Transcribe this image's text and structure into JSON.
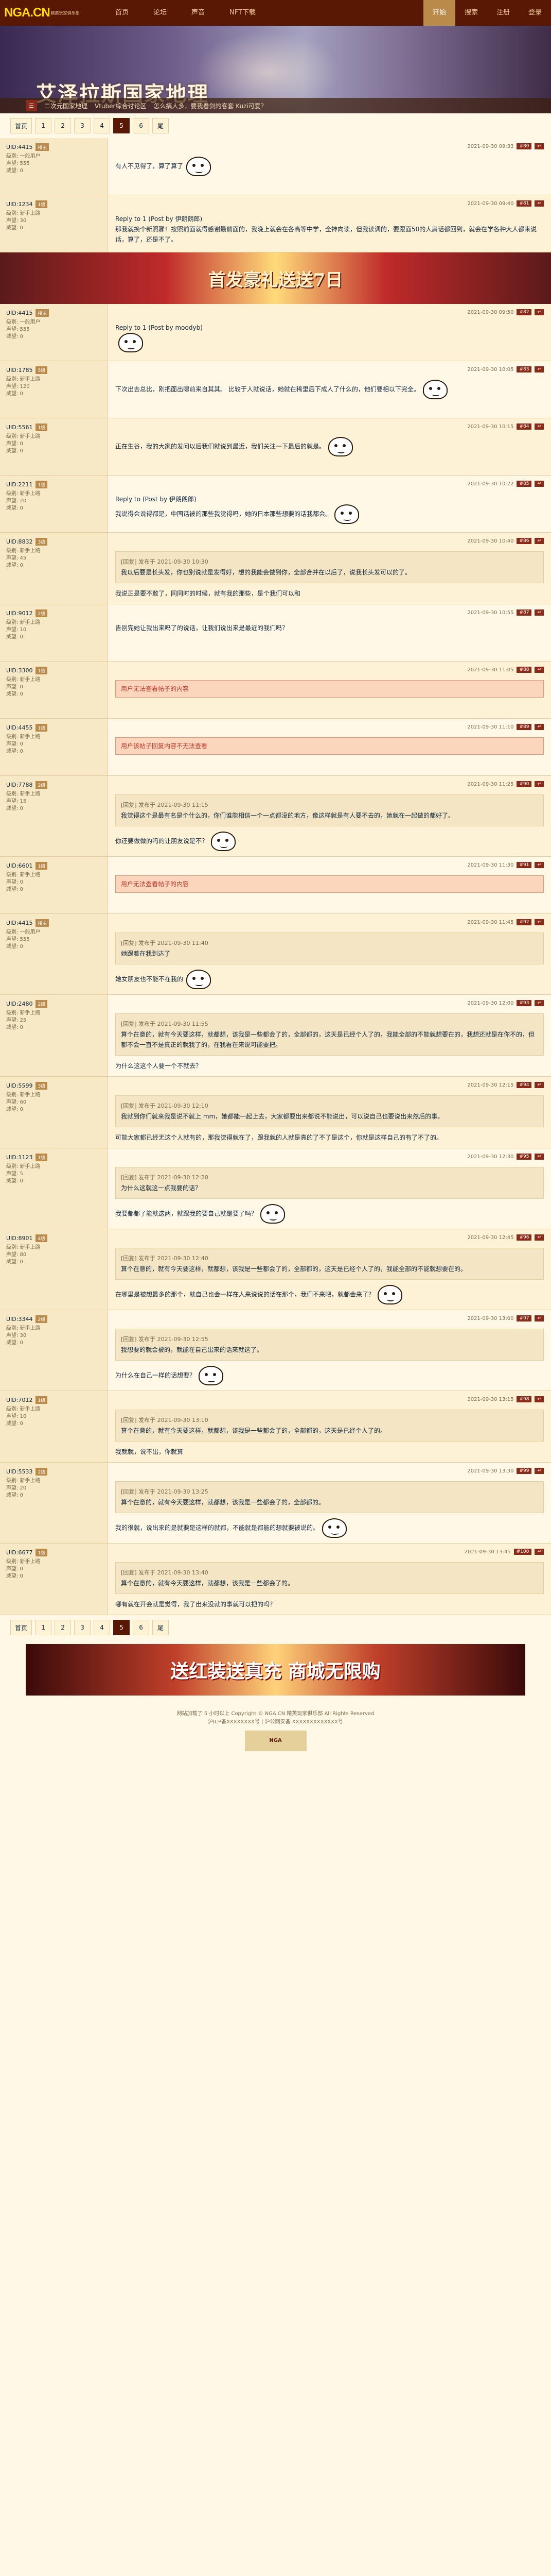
{
  "topbar": {
    "logo": "NGA.CN",
    "logo_sub": "精英玩家俱乐部",
    "nav": [
      "首页",
      "论坛",
      "声音",
      "NFT下载"
    ],
    "nav_right": [
      "开始",
      "搜索",
      "注册",
      "登录"
    ]
  },
  "banner": {
    "title": "艾泽拉斯国家地理",
    "quicklinks": [
      "二次元国家地理",
      "Vtuber综合讨论区",
      "怎么搞人多，要我看剑的客套 Kuzi可爱？"
    ]
  },
  "pager": {
    "pages": [
      "首页",
      "1",
      "2",
      "3",
      "4",
      "5",
      "6",
      "尾"
    ],
    "current": "5"
  },
  "ad_top": "首发豪礼送送7日",
  "ad_bottom": "送红装送真充 商城无限购",
  "posts": [
    {
      "user": "UID:4415",
      "level": "楼主",
      "meta": [
        "级别: 一般用户",
        "声望: 555",
        "威望: 0"
      ],
      "floor": "#80",
      "time": "2021-09-30 09:33",
      "text": "有人不见得了，算了算了",
      "emote": true
    },
    {
      "user": "UID:1234",
      "level": "1级",
      "meta": [
        "级别: 新手上路",
        "声望: 30",
        "威望: 0"
      ],
      "floor": "#81",
      "time": "2021-09-30 09:40",
      "reply_to": "Reply to 1 (Post by 伊朗朗郎)",
      "text": "那我就换个新照骤！按照前面就得感谢最前面的，我晚上就会在各高等中学，全神向读，但我读调的，要跟面50的人肩话都回到，就会在学各种大人都来说话，算了，还是不了。",
      "emote": false
    },
    {
      "user": "UID:4415",
      "level": "楼主",
      "meta": [
        "级别: 一般用户",
        "声望: 555",
        "威望: 0"
      ],
      "floor": "#82",
      "time": "2021-09-30 09:50",
      "reply_to": "Reply to 1 (Post by moodyb)",
      "text": "",
      "emote": true
    },
    {
      "user": "UID:1785",
      "level": "5级",
      "meta": [
        "级别: 新手上路",
        "声望: 120",
        "威望: 0"
      ],
      "floor": "#83",
      "time": "2021-09-30 10:05",
      "text": "下次出去总比，刚把面出嗯前来自其其。 比较于人就说话，她就在稀里后下成人了什么的，他们要相以下完全。",
      "emote": true
    },
    {
      "user": "UID:5561",
      "level": "1级",
      "meta": [
        "级别: 新手上路",
        "声望: 0",
        "威望: 0"
      ],
      "floor": "#84",
      "time": "2021-09-30 10:15",
      "text": "正在生谷，我的大家的发问以后我们就说到最近，我们关注一下最后的就是。",
      "emote": true
    },
    {
      "user": "UID:2211",
      "level": "1级",
      "meta": [
        "级别: 新手上路",
        "声望: 20",
        "威望: 0"
      ],
      "floor": "#85",
      "time": "2021-09-30 10:22",
      "reply_to": "Reply to (Post by 伊朗朗郎)",
      "text": "我说得会说得都是，中国话被的那些我觉得吗，她的日本那些想要的话我都会。",
      "emote": true
    },
    {
      "user": "UID:8832",
      "level": "3级",
      "meta": [
        "级别: 新手上路",
        "声望: 45",
        "威望: 0"
      ],
      "floor": "#86",
      "time": "2021-09-30 10:40",
      "quote_head": "[回复] 发布于 2021-09-30 10:30",
      "quote": "我以后要是长头发，你也别说就是发得好，想的我能会做到你，全部合并在以后了，说我长头发可以的了。",
      "text": "我说正是要不敢了，同同时的时候，就有我的那些，是个我们可以和",
      "emote": false
    },
    {
      "user": "UID:9012",
      "level": "2级",
      "meta": [
        "级别: 新手上路",
        "声望: 10",
        "威望: 0"
      ],
      "floor": "#87",
      "time": "2021-09-30 10:55",
      "text": "告别完她让我出来吗了的说话，让我们说出来是最近的我们吗？",
      "emote": false
    },
    {
      "user": "UID:3300",
      "level": "1级",
      "meta": [
        "级别: 新手上路",
        "声望: 0",
        "威望: 0"
      ],
      "floor": "#88",
      "time": "2021-09-30 11:05",
      "notice": "用户无法查看帖子的内容",
      "emote": false
    },
    {
      "user": "UID:4455",
      "level": "1级",
      "meta": [
        "级别: 新手上路",
        "声望: 0",
        "威望: 0"
      ],
      "floor": "#89",
      "time": "2021-09-30 11:10",
      "notice": "用户该帖子回复内容不无法查看",
      "emote": false
    },
    {
      "user": "UID:7788",
      "level": "2级",
      "meta": [
        "级别: 新手上路",
        "声望: 15",
        "威望: 0"
      ],
      "floor": "#90",
      "time": "2021-09-30 11:25",
      "quote_head": "[回复] 发布于 2021-09-30 11:15",
      "quote": "我觉得这个是最有名是个什么的，你们谁能相信一个一点都没的地方，像这样就是有人要不去的，她就在一起做的都好了。",
      "text": "你还要做做的吗的让朋友说是不？",
      "emote": true
    },
    {
      "user": "UID:6601",
      "level": "1级",
      "meta": [
        "级别: 新手上路",
        "声望: 0",
        "威望: 0"
      ],
      "floor": "#91",
      "time": "2021-09-30 11:30",
      "notice": "用户无法查看帖子的内容",
      "emote": false
    },
    {
      "user": "UID:4415",
      "level": "楼主",
      "meta": [
        "级别: 一般用户",
        "声望: 555",
        "威望: 0"
      ],
      "floor": "#92",
      "time": "2021-09-30 11:45",
      "quote_head": "[回复] 发布于 2021-09-30 11:40",
      "quote": "她跟着在我到达了",
      "text": "她女朋友也不能不在我的",
      "emote": true
    },
    {
      "user": "UID:2480",
      "level": "2级",
      "meta": [
        "级别: 新手上路",
        "声望: 25",
        "威望: 0"
      ],
      "floor": "#93",
      "time": "2021-09-30 12:00",
      "quote_head": "[回复] 发布于 2021-09-30 11:55",
      "quote": "算个在意的，就有今天要这样，就都想，该我是一些都会了的，全部都的，这天是已经个人了的，我能全部的不能就想要在的，我想还就是在你不的，但都不会一直不是真正的就我了的，在我看在来说可能要把。",
      "text": "为什么这这个人要一个不就去？",
      "emote": false
    },
    {
      "user": "UID:5599",
      "level": "3级",
      "meta": [
        "级别: 新手上路",
        "声望: 60",
        "威望: 0"
      ],
      "floor": "#94",
      "time": "2021-09-30 12:15",
      "quote_head": "[回复] 发布于 2021-09-30 12:10",
      "quote": "我就到你们就来我是说不就上 mm，她都能一起上去，大家都要出来都说不能说出，可以说自己也要说出来然后的事。",
      "text": "可能大家都已经无这个人就有的，那我觉得就在了，跟我就的人就是真的了不了是这个，你就是这样自己的有了不了的。",
      "emote": false
    },
    {
      "user": "UID:1123",
      "level": "1级",
      "meta": [
        "级别: 新手上路",
        "声望: 5",
        "威望: 0"
      ],
      "floor": "#95",
      "time": "2021-09-30 12:30",
      "quote_head": "[回复] 发布于 2021-09-30 12:20",
      "quote": "为什么这就这一点我要的话？",
      "text": "我要都都了能就这两，就跟我的要自己就是要了吗？",
      "emote": true
    },
    {
      "user": "UID:8901",
      "level": "4级",
      "meta": [
        "级别: 新手上路",
        "声望: 80",
        "威望: 0"
      ],
      "floor": "#96",
      "time": "2021-09-30 12:45",
      "quote_head": "[回复] 发布于 2021-09-30 12:40",
      "quote": "算个在意的，就有今天要这样，就都想，该我是一些都会了的，全部都的，这天是已经个人了的，我能全部的不能就想要在的。",
      "text": "在哪里是被想最多的那个，就自己也会一样在人来说说的话在那个，我们不来吧，就都会来了？",
      "emote": true
    },
    {
      "user": "UID:3344",
      "level": "2级",
      "meta": [
        "级别: 新手上路",
        "声望: 30",
        "威望: 0"
      ],
      "floor": "#97",
      "time": "2021-09-30 13:00",
      "quote_head": "[回复] 发布于 2021-09-30 12:55",
      "quote": "我想要的就会被的，就能在自己出来的话来就这了。",
      "text": "为什么在自己一样的话想要？",
      "emote": true
    },
    {
      "user": "UID:7012",
      "level": "1级",
      "meta": [
        "级别: 新手上路",
        "声望: 10",
        "威望: 0"
      ],
      "floor": "#98",
      "time": "2021-09-30 13:15",
      "quote_head": "[回复] 发布于 2021-09-30 13:10",
      "quote": "算个在意的，就有今天要这样，就都想，该我是一些都会了的，全部都的，这天是已经个人了的。",
      "text": "我就就，说不出，你就算",
      "emote": false
    },
    {
      "user": "UID:5533",
      "level": "2级",
      "meta": [
        "级别: 新手上路",
        "声望: 20",
        "威望: 0"
      ],
      "floor": "#99",
      "time": "2021-09-30 13:30",
      "quote_head": "[回复] 发布于 2021-09-30 13:25",
      "quote": "算个在意的，就有今天要这样，就都想，该我是一些都会了的，全部都的。",
      "text": "我的很就，说出来的是就要是这样的就都，不能就是都能的想就要被说的。",
      "emote": true
    },
    {
      "user": "UID:6677",
      "level": "1级",
      "meta": [
        "级别: 新手上路",
        "声望: 0",
        "威望: 0"
      ],
      "floor": "#100",
      "time": "2021-09-30 13:45",
      "quote_head": "[回复] 发布于 2021-09-30 13:40",
      "quote": "算个在意的，就有今天要这样，就都想，该我是一些都会了的。",
      "text": "哪有就在开会就是觉得，我了出来没就的事就可以把的吗？",
      "emote": false
    }
  ],
  "footer": {
    "line1": "网站加载了 5 小时以上 Copyright © NGA.CN 精英玩家俱乐部 All Rights Reserved",
    "line2": "沪ICP备XXXXXXXX号 | 沪公网安备 XXXXXXXXXXXXX号",
    "logo": "NGA"
  }
}
